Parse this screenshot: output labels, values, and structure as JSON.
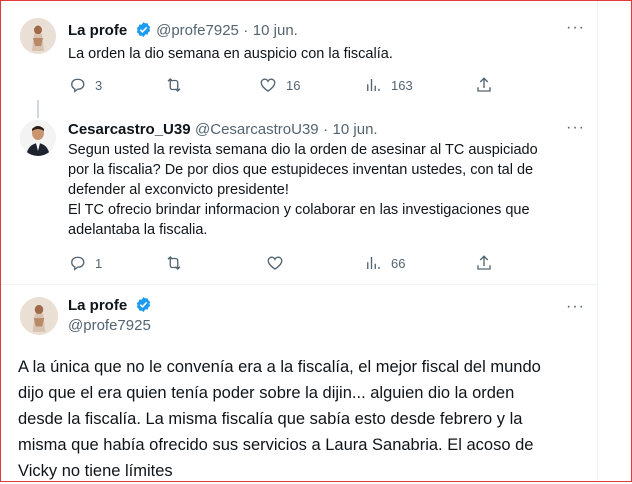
{
  "tweet1": {
    "name": "La profe",
    "handle": "@profe7925",
    "sep": "·",
    "date": "10 jun.",
    "text": "La orden la dio semana en auspicio con la fiscalía.",
    "replies": "3",
    "likes": "16",
    "views": "163"
  },
  "tweet2": {
    "name": "Cesarcastro_U39",
    "handle": "@CesarcastroU39",
    "sep": "·",
    "date": "10 jun.",
    "lines": [
      "Segun usted la revista semana dio la orden de asesinar al TC auspiciado",
      "por la fiscalia? De por dios que estupideces inventan ustedes, con tal de",
      "defender al exconvicto presidente!",
      "El TC ofrecio brindar informacion y colaborar en las investigaciones que",
      "adelantaba la fiscalia."
    ],
    "replies": "1",
    "views": "66"
  },
  "tweet3": {
    "name": "La profe",
    "handle": "@profe7925",
    "lines": [
      "A la única que no le convenía era a la fiscalía, el mejor fiscal del mundo",
      "dijo que el era quien tenía poder sobre la dijin... alguien dio la orden",
      "desde la fiscalía. La misma fiscalía que sabía esto desde febrero y la",
      "misma que había ofrecido sus servicios a Laura Sanabria. El acoso de",
      "Vicky no tiene límites"
    ]
  },
  "colors": {
    "verified": "#1d9bf0",
    "secondary": "#536471",
    "frame": "#e03a3a"
  },
  "icons": [
    "reply-icon",
    "retweet-icon",
    "like-icon",
    "views-icon",
    "share-icon",
    "more-icon",
    "verified-badge-icon"
  ]
}
